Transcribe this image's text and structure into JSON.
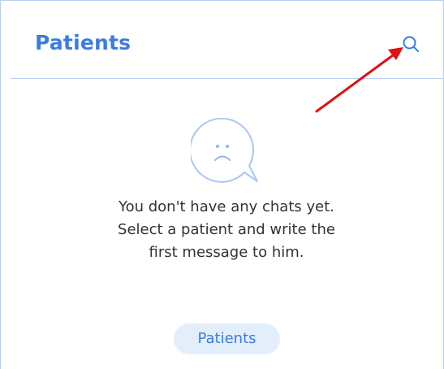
{
  "header": {
    "title": "Patients",
    "search_icon": "search-icon"
  },
  "empty_state": {
    "icon": "sad-chat-bubble-icon",
    "message": "You don't have any chats yet. Select a patient and write the first message to him."
  },
  "actions": {
    "patients_button_label": "Patients"
  },
  "colors": {
    "accent": "#3a7ce0",
    "button_bg": "#e3eefb",
    "divider": "#b9cdef",
    "annotation_arrow": "#e01010"
  }
}
